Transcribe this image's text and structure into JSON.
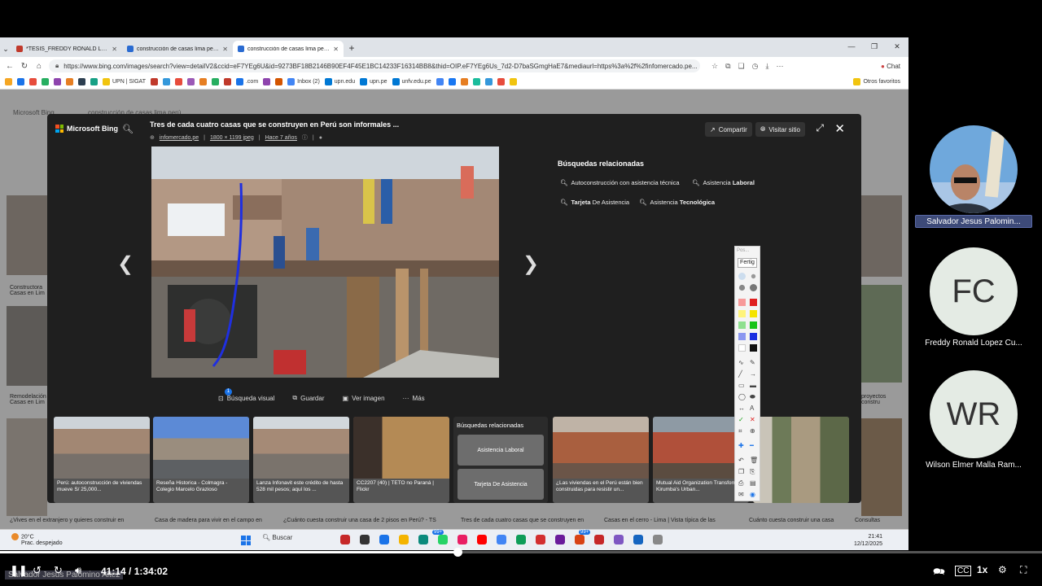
{
  "browser": {
    "tabs": [
      {
        "label": "*TESIS_FREDDY RONALD LOPEZ C",
        "color": "#c0392b",
        "active": false
      },
      {
        "label": "construcción de casas lima perú -",
        "color": "#2a6bd1",
        "active": false
      },
      {
        "label": "construcción de casas lima perú -",
        "color": "#2a6bd1",
        "active": true
      }
    ],
    "url": "https://www.bing.com/images/search?view=detailV2&ccid=eF7YEg6U&id=9273BF18B2146B90EF4F45E1BC14233F16314BB8&thid=OIP.eF7YEg6Us_7d2-D7baSGmgHaE7&mediaurl=https%3a%2f%2finfomercado.pe...",
    "chat_label": "Chat",
    "bookmarks": [
      "UPN | SIGAT",
      ".com",
      "Inbox (2)",
      "upn.edu",
      "upn.pe",
      "unfv.edu.pe"
    ],
    "other_bookmarks": "Otros favoritos"
  },
  "bing_bg": {
    "captions": [
      "Constructora Casas en Lim",
      "Remodelación Casas en Lim",
      "¿Vives en el extranjero y quieres construir en",
      "Casa de madera para vivir en el campo en",
      "¿Cuánto cuesta construir una casa de 2 pisos en Perú? - TS",
      "Tres de cada cuatro casas que se construyen en",
      "Casas en el cerro - Lima | Vista típica de las",
      "Cuánto cuesta construir una casa",
      "proyectos constru",
      "Consultas",
      "construcción de casas lima perú",
      "Microsoft Bing"
    ]
  },
  "modal": {
    "logo": "Microsoft Bing",
    "title": "Tres de cada cuatro casas que se construyen en Perú son informales ...",
    "source": "infomercado.pe",
    "size": "1800 × 1199 jpeg",
    "age": "Hace 7 años",
    "share_label": "Compartir",
    "visit_label": "Visitar sitio",
    "related_title": "Búsquedas relacionadas",
    "related": [
      {
        "plain": "Autoconstrucción con asistencia técnica",
        "bold": ""
      },
      {
        "plain": "Asistencia ",
        "bold": "Laboral"
      },
      {
        "plain": "",
        "bold": "Tarjeta",
        "rest": " De Asistencia"
      },
      {
        "plain": "Asistencia ",
        "bold": "Tecnológica"
      }
    ],
    "actions": {
      "visual_search": "Búsqueda visual",
      "visual_badge": "1",
      "save": "Guardar",
      "view_image": "Ver imagen",
      "more": "Más"
    },
    "strip": [
      "Perú: autoconstrucción de viviendas mueve S/ 25,000...",
      "Reseña Historica - Colmagra - Colegio Marcelo Grazioso",
      "Lanza Infonavit este crédito de hasta 528 mil pesos; aquí los ...",
      "CC2207 (40) | TETO no Paraná | Flickr",
      "¿Las viviendas en el Perú están bien construidas para resistir un...",
      "Mutual Aid Organization Transforms Kirumba's Urban..."
    ],
    "strip_related": {
      "title": "Búsquedas relacionadas",
      "a": "Asistencia Laboral",
      "b": "Tarjeta De Asistencia"
    }
  },
  "annotation_toolbar": {
    "done_label": "Fertig",
    "header": "Pos..."
  },
  "taskbar": {
    "temp": "20°C",
    "weather": "Prac. despejado",
    "search": "Buscar",
    "time": "21:41",
    "date": "12/12/2025",
    "badge1": "99+",
    "badge2": "99+"
  },
  "participants": [
    {
      "name": "Salvador Jesus Palomin...",
      "initials": "",
      "highlight": true
    },
    {
      "name": "Freddy Ronald Lopez Cu...",
      "initials": "FC",
      "highlight": false
    },
    {
      "name": "Wilson Elmer Malla Ram...",
      "initials": "WR",
      "highlight": false
    }
  ],
  "player": {
    "current_time": "41:14",
    "separator": " / ",
    "duration": "1:34:02",
    "speed": "1x",
    "progress_fraction": 0.439,
    "caption_name": "Salvador Jesus Palomino Altez"
  }
}
